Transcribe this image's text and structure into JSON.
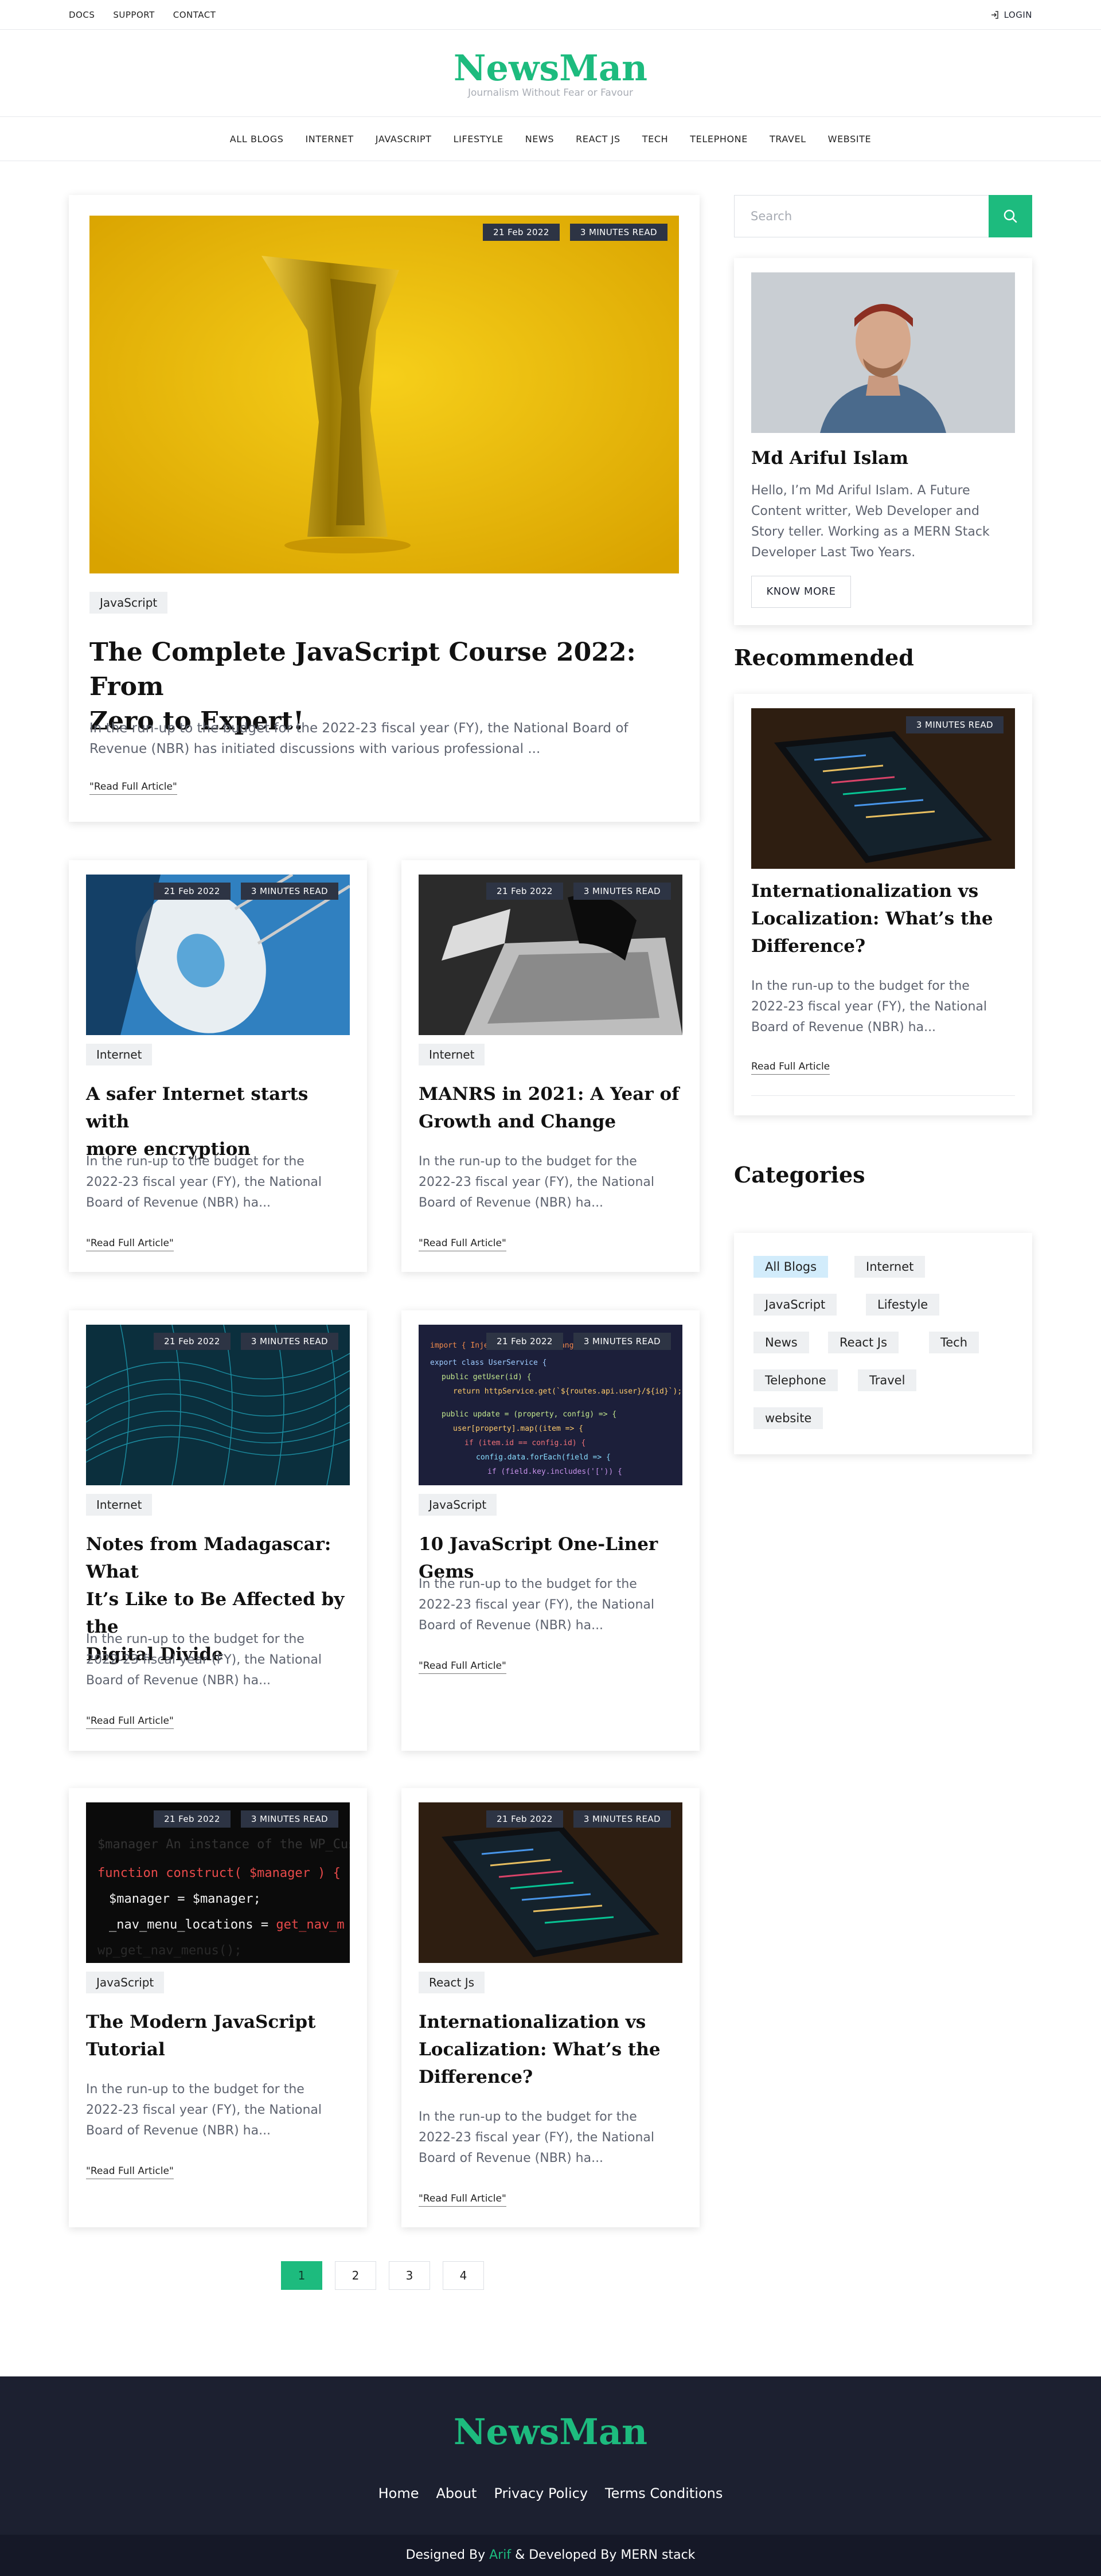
{
  "topbar": {
    "links": [
      "DOCS",
      "SUPPORT",
      "CONTACT"
    ],
    "login": "LOGIN"
  },
  "header": {
    "brand": "NewsMan",
    "tagline": "Journalism Without Fear or Favour"
  },
  "nav": [
    "ALL BLOGS",
    "INTERNET",
    "JAVASCRIPT",
    "LIFESTYLE",
    "NEWS",
    "REACT JS",
    "TECH",
    "TELEPHONE",
    "TRAVEL",
    "WEBSITE"
  ],
  "featured": {
    "date": "21 Feb 2022",
    "read": "3 MINUTES READ",
    "category": "JavaScript",
    "title_line1": "The Complete JavaScript Course 2022: From",
    "title_line2": "Zero to Expert!",
    "excerpt_line1": "In the run-up to the budget for the 2022-23 fiscal year (FY), the National Board of",
    "excerpt_line2": "Revenue (NBR) has initiated discussions with various professional ...",
    "more": "\"Read Full Article\""
  },
  "posts": [
    {
      "date": "21 Feb 2022",
      "read": "3 MINUTES READ",
      "category": "Internet",
      "title": [
        "A safer Internet starts with",
        "more encryption"
      ],
      "excerpt": [
        "In the run-up to the budget for the",
        "2022-23 fiscal year (FY), the National",
        "Board of Revenue (NBR) ha..."
      ],
      "more": "\"Read Full Article\""
    },
    {
      "date": "21 Feb 2022",
      "read": "3 MINUTES READ",
      "category": "Internet",
      "title": [
        "MANRS in 2021: A Year of",
        "Growth and Change"
      ],
      "excerpt": [
        "In the run-up to the budget for the",
        "2022-23 fiscal year (FY), the National",
        "Board of Revenue (NBR) ha..."
      ],
      "more": "\"Read Full Article\""
    },
    {
      "date": "21 Feb 2022",
      "read": "3 MINUTES READ",
      "category": "Internet",
      "title": [
        "Notes from Madagascar: What",
        "It’s Like to Be Affected by the",
        "Digital Divide"
      ],
      "excerpt": [
        "In the run-up to the budget for the",
        "2022-23 fiscal year (FY), the National",
        "Board of Revenue (NBR) ha..."
      ],
      "more": "\"Read Full Article\""
    },
    {
      "date": "21 Feb 2022",
      "read": "3 MINUTES READ",
      "category": "JavaScript",
      "title": [
        "10 JavaScript One-Liner Gems"
      ],
      "excerpt": [
        "In the run-up to the budget for the",
        "2022-23 fiscal year (FY), the National",
        "Board of Revenue (NBR) ha..."
      ],
      "more": "\"Read Full Article\""
    },
    {
      "date": "21 Feb 2022",
      "read": "3 MINUTES READ",
      "category": "JavaScript",
      "title": [
        "The Modern JavaScript",
        "Tutorial"
      ],
      "excerpt": [
        "In the run-up to the budget for the",
        "2022-23 fiscal year (FY), the National",
        "Board of Revenue (NBR) ha..."
      ],
      "more": "\"Read Full Article\""
    },
    {
      "date": "21 Feb 2022",
      "read": "3 MINUTES READ",
      "category": "React Js",
      "title": [
        "Internationalization vs",
        "Localization: What’s the",
        "Difference?"
      ],
      "excerpt": [
        "In the run-up to the budget for the",
        "2022-23 fiscal year (FY), the National",
        "Board of Revenue (NBR) ha..."
      ],
      "more": "\"Read Full Article\""
    }
  ],
  "sidebar": {
    "search_placeholder": "Search",
    "author": {
      "name": "Md Ariful Islam",
      "bio": [
        "Hello, I’m Md Ariful Islam. A Future",
        "Content writter, Web Developer and",
        "Story teller. Working as a MERN Stack",
        "Developer Last Two Years."
      ],
      "button": "KNOW MORE"
    },
    "recommended": {
      "heading": "Recommended",
      "read": "3 MINUTES READ",
      "title": [
        "Internationalization vs",
        "Localization: What’s the",
        "Difference?"
      ],
      "excerpt": [
        "In the run-up to the budget for the",
        "2022-23 fiscal year (FY), the National",
        "Board of Revenue (NBR) ha..."
      ],
      "more": "Read Full Article"
    },
    "categories": {
      "heading": "Categories",
      "tags": [
        "All Blogs",
        "Internet",
        "JavaScript",
        "Lifestyle",
        "News",
        "React Js",
        "Tech",
        "Telephone",
        "Travel",
        "website"
      ]
    }
  },
  "pagination": [
    "1",
    "2",
    "3",
    "4"
  ],
  "footer": {
    "brand": "NewsMan",
    "links": [
      "Home",
      "About",
      "Privacy Policy",
      "Terms Conditions"
    ],
    "credit_pre": "Designed By ",
    "credit_name": "Arif",
    "credit_post": " & Developed By MERN stack"
  },
  "colors": {
    "accent": "#1dbb7e",
    "badge": "#2d3444",
    "footer": "#1c2030"
  }
}
